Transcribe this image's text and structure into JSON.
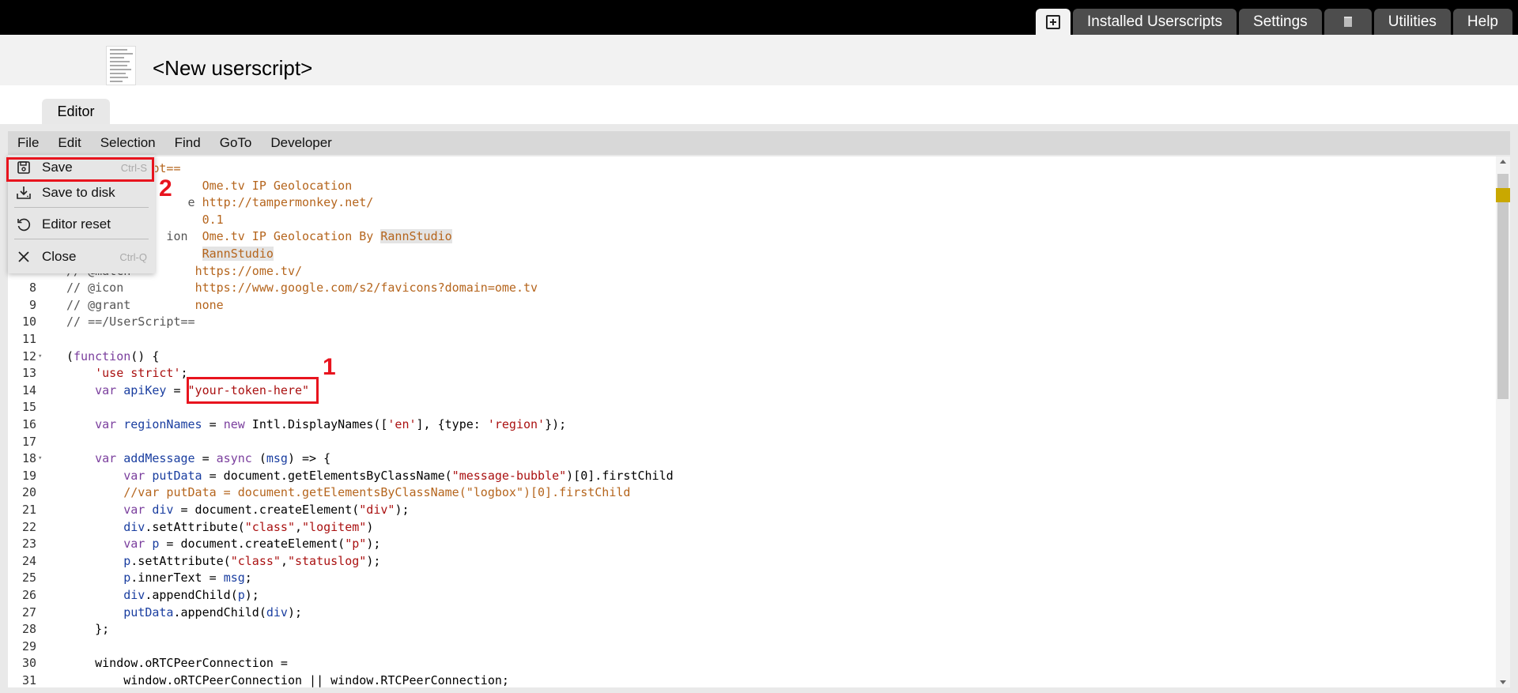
{
  "tabs": {
    "add_icon": "plus-square-icon",
    "installed": "Installed Userscripts",
    "settings": "Settings",
    "trash_icon": "trash-icon",
    "utilities": "Utilities",
    "help": "Help"
  },
  "header": {
    "title": "<New userscript>",
    "editor_tab": "Editor"
  },
  "menubar": {
    "items": [
      "File",
      "Edit",
      "Selection",
      "Find",
      "GoTo",
      "Developer"
    ]
  },
  "file_menu": {
    "items": [
      {
        "label": "Save",
        "shortcut": "Ctrl-S",
        "icon": "save-icon"
      },
      {
        "label": "Save to disk",
        "shortcut": "",
        "icon": "download-icon"
      },
      {
        "label": "Editor reset",
        "shortcut": "",
        "icon": "reset-icon"
      },
      {
        "label": "Close",
        "shortcut": "Ctrl-Q",
        "icon": "close-icon"
      }
    ]
  },
  "annotations": {
    "one": "1",
    "two": "2"
  },
  "code": {
    "lines": [
      {
        "n": "",
        "fold": "",
        "segs": [
          [
            "c-com",
            "           "
          ],
          [
            "c-meta",
            "ipt=="
          ]
        ]
      },
      {
        "n": "",
        "fold": "",
        "segs": [
          [
            "c-com",
            "                   "
          ],
          [
            "c-meta",
            "Ome.tv IP Geolocation"
          ]
        ]
      },
      {
        "n": "",
        "fold": "",
        "segs": [
          [
            "c-com",
            "                 e "
          ],
          [
            "c-meta",
            "http://tampermonkey.net/"
          ]
        ]
      },
      {
        "n": "",
        "fold": "",
        "segs": [
          [
            "c-com",
            "                   "
          ],
          [
            "c-meta",
            "0.1"
          ]
        ]
      },
      {
        "n": "",
        "fold": "",
        "segs": [
          [
            "c-com",
            "              ion  "
          ],
          [
            "c-meta",
            "Ome.tv IP Geolocation By "
          ],
          [
            "c-meta hl",
            "RannStudio"
          ]
        ]
      },
      {
        "n": "",
        "fold": "",
        "segs": [
          [
            "c-com",
            "                   "
          ],
          [
            "c-meta hl",
            "RannStudio"
          ]
        ]
      },
      {
        "n": "",
        "fold": "",
        "segs": [
          [
            "c-com",
            "// @match         "
          ],
          [
            "c-meta",
            "https://ome.tv/"
          ]
        ]
      },
      {
        "n": "8",
        "fold": "",
        "segs": [
          [
            "c-com",
            "// @icon          "
          ],
          [
            "c-meta",
            "https://www.google.com/s2/favicons?domain=ome.tv"
          ]
        ]
      },
      {
        "n": "9",
        "fold": "",
        "segs": [
          [
            "c-com",
            "// @grant         "
          ],
          [
            "c-meta",
            "none"
          ]
        ]
      },
      {
        "n": "10",
        "fold": "",
        "segs": [
          [
            "c-com",
            "// ==/UserScript=="
          ]
        ]
      },
      {
        "n": "11",
        "fold": "",
        "segs": []
      },
      {
        "n": "12",
        "fold": "▾",
        "segs": [
          [
            "",
            "("
          ],
          [
            "c-kw",
            "function"
          ],
          [
            "",
            "() {"
          ]
        ]
      },
      {
        "n": "13",
        "fold": "",
        "segs": [
          [
            "",
            "    "
          ],
          [
            "c-str",
            "'use strict'"
          ],
          [
            "",
            ";"
          ]
        ]
      },
      {
        "n": "14",
        "fold": "",
        "segs": [
          [
            "",
            "    "
          ],
          [
            "c-kw",
            "var"
          ],
          [
            "",
            " "
          ],
          [
            "c-var",
            "apiKey"
          ],
          [
            "",
            " = "
          ],
          [
            "c-str",
            "\"your-token-here\""
          ]
        ]
      },
      {
        "n": "15",
        "fold": "",
        "segs": []
      },
      {
        "n": "16",
        "fold": "",
        "segs": [
          [
            "",
            "    "
          ],
          [
            "c-kw",
            "var"
          ],
          [
            "",
            " "
          ],
          [
            "c-var",
            "regionNames"
          ],
          [
            "",
            " = "
          ],
          [
            "c-kw",
            "new"
          ],
          [
            "",
            " Intl.DisplayNames(["
          ],
          [
            "c-str",
            "'en'"
          ],
          [
            "",
            "], {type: "
          ],
          [
            "c-str",
            "'region'"
          ],
          [
            "",
            "});"
          ]
        ]
      },
      {
        "n": "17",
        "fold": "",
        "segs": []
      },
      {
        "n": "18",
        "fold": "▾",
        "segs": [
          [
            "",
            "    "
          ],
          [
            "c-kw",
            "var"
          ],
          [
            "",
            " "
          ],
          [
            "c-var",
            "addMessage"
          ],
          [
            "",
            " = "
          ],
          [
            "c-kw",
            "async"
          ],
          [
            "",
            " ("
          ],
          [
            "c-var",
            "msg"
          ],
          [
            "",
            ") => {"
          ]
        ]
      },
      {
        "n": "19",
        "fold": "",
        "segs": [
          [
            "",
            "        "
          ],
          [
            "c-kw",
            "var"
          ],
          [
            "",
            " "
          ],
          [
            "c-var",
            "putData"
          ],
          [
            "",
            " = document.getElementsByClassName("
          ],
          [
            "c-str",
            "\"message-bubble\""
          ],
          [
            "",
            ")[0].firstChild"
          ]
        ]
      },
      {
        "n": "20",
        "fold": "",
        "segs": [
          [
            "c-meta",
            "        //var putData = document.getElementsByClassName(\"logbox\")[0].firstChild"
          ]
        ]
      },
      {
        "n": "21",
        "fold": "",
        "segs": [
          [
            "",
            "        "
          ],
          [
            "c-kw",
            "var"
          ],
          [
            "",
            " "
          ],
          [
            "c-var",
            "div"
          ],
          [
            "",
            " = document.createElement("
          ],
          [
            "c-str",
            "\"div\""
          ],
          [
            "",
            ");"
          ]
        ]
      },
      {
        "n": "22",
        "fold": "",
        "segs": [
          [
            "",
            "        "
          ],
          [
            "c-var",
            "div"
          ],
          [
            "",
            ".setAttribute("
          ],
          [
            "c-str",
            "\"class\""
          ],
          [
            "",
            ","
          ],
          [
            "c-str",
            "\"logitem\""
          ],
          [
            "",
            ")"
          ]
        ]
      },
      {
        "n": "23",
        "fold": "",
        "segs": [
          [
            "",
            "        "
          ],
          [
            "c-kw",
            "var"
          ],
          [
            "",
            " "
          ],
          [
            "c-var",
            "p"
          ],
          [
            "",
            " = document.createElement("
          ],
          [
            "c-str",
            "\"p\""
          ],
          [
            "",
            ");"
          ]
        ]
      },
      {
        "n": "24",
        "fold": "",
        "segs": [
          [
            "",
            "        "
          ],
          [
            "c-var",
            "p"
          ],
          [
            "",
            ".setAttribute("
          ],
          [
            "c-str",
            "\"class\""
          ],
          [
            "",
            ","
          ],
          [
            "c-str",
            "\"statuslog\""
          ],
          [
            "",
            ");"
          ]
        ]
      },
      {
        "n": "25",
        "fold": "",
        "segs": [
          [
            "",
            "        "
          ],
          [
            "c-var",
            "p"
          ],
          [
            "",
            ".innerText = "
          ],
          [
            "c-var",
            "msg"
          ],
          [
            "",
            ";"
          ]
        ]
      },
      {
        "n": "26",
        "fold": "",
        "segs": [
          [
            "",
            "        "
          ],
          [
            "c-var",
            "div"
          ],
          [
            "",
            ".appendChild("
          ],
          [
            "c-var",
            "p"
          ],
          [
            "",
            ");"
          ]
        ]
      },
      {
        "n": "27",
        "fold": "",
        "segs": [
          [
            "",
            "        "
          ],
          [
            "c-var",
            "putData"
          ],
          [
            "",
            ".appendChild("
          ],
          [
            "c-var",
            "div"
          ],
          [
            "",
            ");"
          ]
        ]
      },
      {
        "n": "28",
        "fold": "",
        "segs": [
          [
            "",
            "    };"
          ]
        ]
      },
      {
        "n": "29",
        "fold": "",
        "segs": []
      },
      {
        "n": "30",
        "fold": "",
        "segs": [
          [
            "",
            "    window.oRTCPeerConnection ="
          ]
        ]
      },
      {
        "n": "31",
        "fold": "",
        "segs": [
          [
            "",
            "        window.oRTCPeerConnection || window.RTCPeerConnection;"
          ]
        ]
      }
    ]
  }
}
